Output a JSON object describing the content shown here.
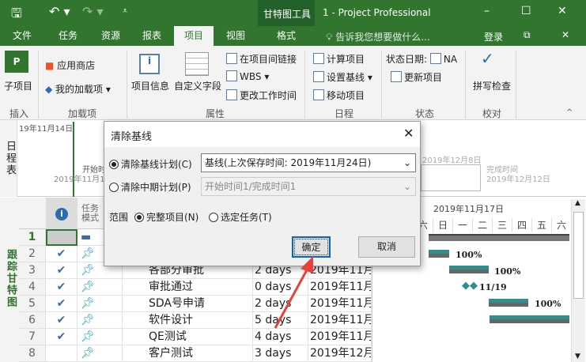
{
  "titlebar": {
    "context_tab": "甘特图工具",
    "title": "1 - Project Professional"
  },
  "tabs": [
    "文件",
    "任务",
    "资源",
    "报表",
    "项目",
    "视图",
    "格式"
  ],
  "active_tab": "项目",
  "tell_me": "告诉我您想要做什么...",
  "signin": "登录",
  "ribbon": {
    "subproject": "子项目",
    "app_store": "应用商店",
    "my_addins": "我的加载项",
    "project_info": "项目信息",
    "custom_fields": "自定义字段",
    "link_projects": "在项目间链接",
    "wbs": "WBS",
    "change_working_time": "更改工作时间",
    "calc_project": "计算项目",
    "set_baseline": "设置基线",
    "move_project": "移动项目",
    "status_date_label": "状态日期:",
    "status_date_value": "NA",
    "update_project": "更新项目",
    "spelling": "拼写检查",
    "groups": [
      "插入",
      "加载项",
      "属性",
      "日程",
      "状态",
      "校对"
    ]
  },
  "timeline": {
    "label": "日程表",
    "start_date_top": "19年11月14日",
    "start_label": "开始时",
    "start_date": "2019年11月1",
    "mid_date": "2019年12月8日",
    "finish_label": "完成时间",
    "finish_date": "2019年12月12日"
  },
  "gantt": {
    "side_label": "跟踪甘特图",
    "header_mode": "任务模式",
    "week_label": "2019年11月17日",
    "days": [
      "六",
      "日",
      "一",
      "二",
      "三",
      "四",
      "五",
      "六"
    ],
    "rows": [
      {
        "n": "1",
        "done": false,
        "name": "",
        "dur": "",
        "start": ""
      },
      {
        "n": "2",
        "done": true,
        "name": "",
        "dur": "",
        "start": ""
      },
      {
        "n": "3",
        "done": true,
        "name": "各部分审批",
        "dur": "2 days",
        "start": "2019年11月"
      },
      {
        "n": "4",
        "done": true,
        "name": "审批通过",
        "dur": "0 days",
        "start": "2019年11月"
      },
      {
        "n": "5",
        "done": true,
        "name": "SDA号申请",
        "dur": "2 days",
        "start": "2019年11月"
      },
      {
        "n": "6",
        "done": true,
        "name": "软件设计",
        "dur": "5 days",
        "start": "2019年11月"
      },
      {
        "n": "7",
        "done": true,
        "name": "QE测试",
        "dur": "4 days",
        "start": "2019年11月"
      },
      {
        "n": "8",
        "done": false,
        "name": "客户测试",
        "dur": "3 days",
        "start": "2019年12月"
      }
    ],
    "bar_labels": [
      "100%",
      "100%",
      "11/19",
      "100%"
    ]
  },
  "dialog": {
    "title": "清除基线",
    "opt_baseline": "清除基线计划(C)",
    "baseline_select": "基线(上次保存时间: 2019年11月24日)",
    "opt_interim": "清除中期计划(P)",
    "interim_select": "开始时间1/完成时间1",
    "scope_label": "范围",
    "scope_all": "完整项目(N)",
    "scope_selected": "选定任务(T)",
    "ok": "确定",
    "cancel": "取消"
  },
  "colors": {
    "accent": "#31752f",
    "bar": "#2f8f8f",
    "arrow": "#e8403a"
  }
}
